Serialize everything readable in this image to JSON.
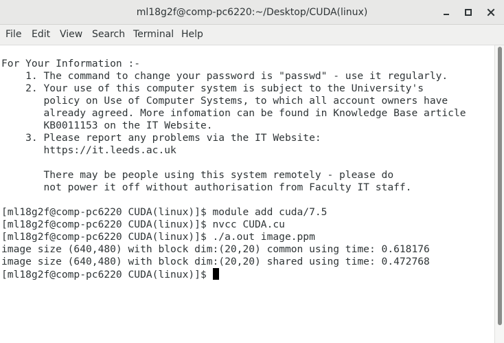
{
  "window": {
    "title": "ml18g2f@comp-pc6220:~/Desktop/CUDA(linux)",
    "controls": [
      "minimize-icon",
      "maximize-icon",
      "close-icon"
    ]
  },
  "menu": {
    "items": [
      "File",
      "Edit",
      "View",
      "Search",
      "Terminal",
      "Help"
    ]
  },
  "terminal": {
    "lines": [
      "For Your Information :-",
      "    1. The command to change your password is \"passwd\" - use it regularly.",
      "    2. Your use of this computer system is subject to the University's",
      "       policy on Use of Computer Systems, to which all account owners have",
      "       already agreed. More infomation can be found in Knowledge Base article",
      "       KB0011153 on the IT Website.",
      "    3. Please report any problems via the IT Website:",
      "       https://it.leeds.ac.uk",
      "",
      "       There may be people using this system remotely - please do",
      "       not power it off without authorisation from Faculty IT staff.",
      "",
      "[ml18g2f@comp-pc6220 CUDA(linux)]$ module add cuda/7.5",
      "[ml18g2f@comp-pc6220 CUDA(linux)]$ nvcc CUDA.cu",
      "[ml18g2f@comp-pc6220 CUDA(linux)]$ ./a.out image.ppm",
      "image size (640,480) with block dim:(20,20) common using time: 0.618176",
      "image size (640,480) with block dim:(20,20) shared using time: 0.472768"
    ],
    "prompt": "[ml18g2f@comp-pc6220 CUDA(linux)]$ "
  },
  "colors": {
    "text": "#2e3436",
    "titlebar": "#e8e8e7",
    "menubar": "#f0f0ef",
    "scroll_thumb": "#8a8c8a"
  }
}
